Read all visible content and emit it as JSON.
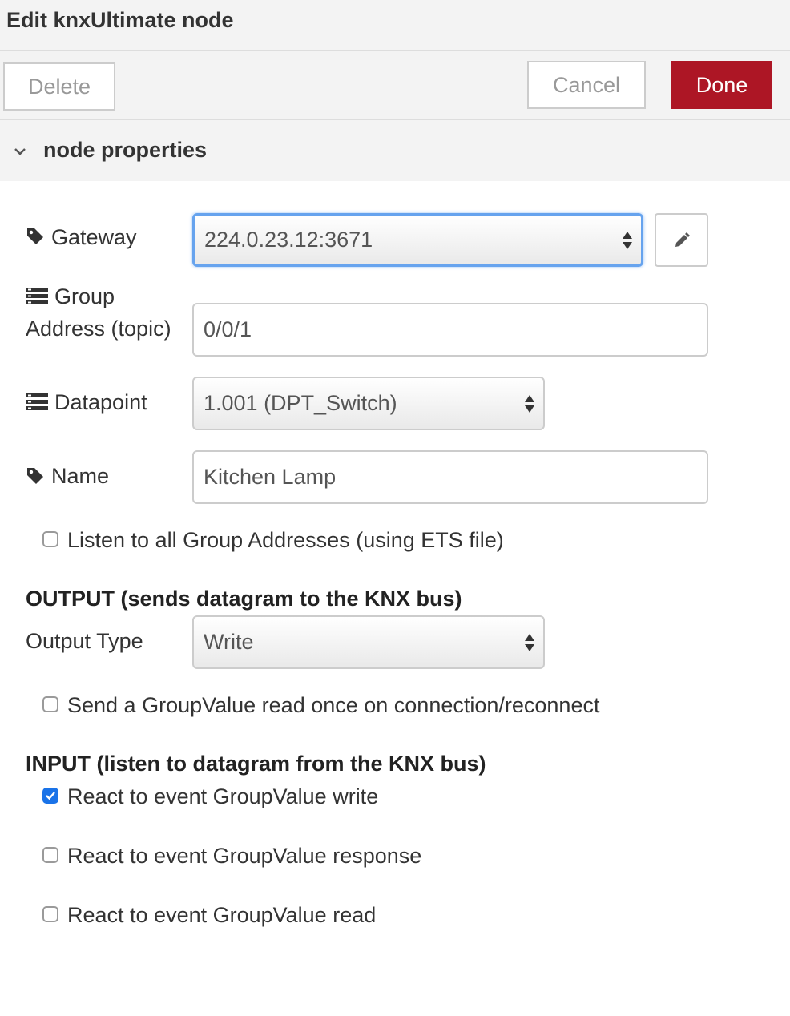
{
  "header": {
    "title": "Edit knxUltimate node"
  },
  "toolbar": {
    "delete_label": "Delete",
    "cancel_label": "Cancel",
    "done_label": "Done"
  },
  "section": {
    "title": "node properties",
    "icon": "chevron-down-icon"
  },
  "form": {
    "gateway": {
      "label": "Gateway",
      "icon": "tag-icon",
      "value": "224.0.23.12:3671",
      "edit_icon": "pencil-icon"
    },
    "group_address": {
      "label_line1": "Group",
      "label_line2": "Address (topic)",
      "icon": "list-icon",
      "value": "0/0/1"
    },
    "datapoint": {
      "label": "Datapoint",
      "icon": "list-icon",
      "value": "1.001 (DPT_Switch)"
    },
    "name": {
      "label": "Name",
      "icon": "tag-icon",
      "value": "Kitchen Lamp"
    },
    "listen_all": {
      "label": "Listen to all Group Addresses (using ETS file)",
      "checked": false
    }
  },
  "output": {
    "heading": "OUTPUT (sends datagram to the KNX bus)",
    "type_label": "Output Type",
    "type_value": "Write",
    "read_on_connect": {
      "label": "Send a GroupValue read once on connection/reconnect",
      "checked": false
    }
  },
  "input": {
    "heading": "INPUT (listen to datagram from the KNX bus)",
    "options": [
      {
        "label": "React to event GroupValue write",
        "checked": true
      },
      {
        "label": "React to event GroupValue response",
        "checked": false
      },
      {
        "label": "React to event GroupValue read",
        "checked": false
      }
    ]
  },
  "colors": {
    "done": "#ad1625",
    "focus": "#66a3ee",
    "checkbox_checked": "#1a73e8"
  }
}
